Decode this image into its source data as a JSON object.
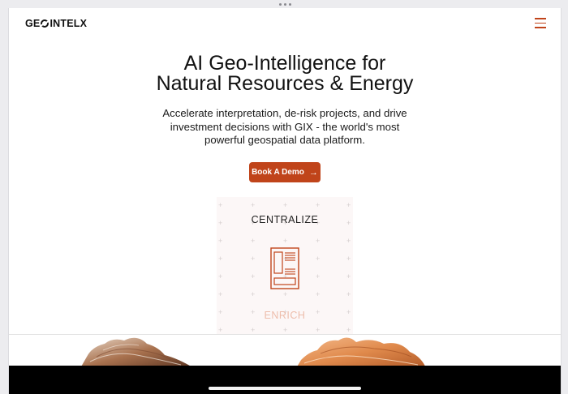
{
  "brand": {
    "logo_text_a": "GE",
    "logo_text_b": "INTEL",
    "logo_text_c": "X"
  },
  "header": {
    "menu_icon": "hamburger-menu-icon"
  },
  "hero": {
    "title_line1": "AI Geo-Intelligence for",
    "title_line2": "Natural Resources & Energy",
    "subtitle_line1": "Accelerate interpretation, de-risk projects, and drive",
    "subtitle_line2": "investment decisions with GIX - the world's most",
    "subtitle_line3": "powerful geospatial data platform.",
    "cta_label": "Book A Demo",
    "cta_icon": "arrow-right-icon"
  },
  "feature": {
    "active_word": "CENTRALIZE",
    "next_word": "ENRICH",
    "icon": "document-panel-icon"
  },
  "colors": {
    "accent": "#c0441a",
    "panel_bg": "#fcf7f7",
    "text": "#111111"
  }
}
